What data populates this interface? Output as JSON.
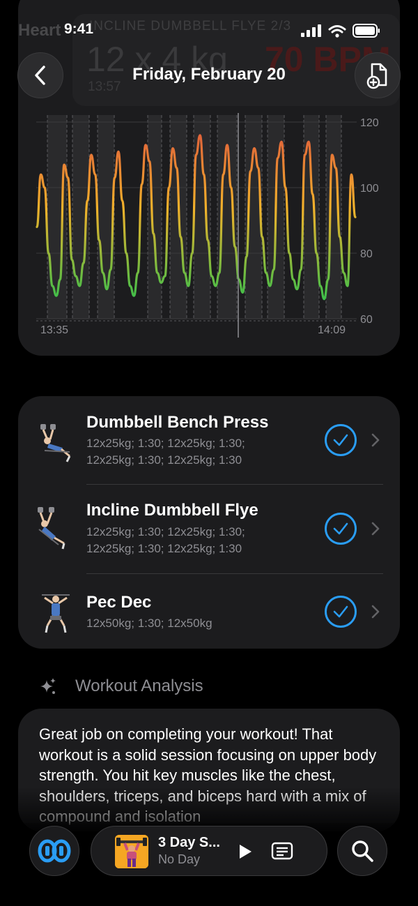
{
  "status_bar": {
    "time": "9:41"
  },
  "header": {
    "title": "Friday, February 20"
  },
  "background_overlay": {
    "section_title": "Heart",
    "exercise_label": "INCLINE DUMBBELL FLYE 2/3",
    "set_value": "12 x 4 kg",
    "elapsed": "13:57",
    "bpm": "70 BPM"
  },
  "heart_rate_chart": {
    "y_ticks": [
      "120",
      "100",
      "80",
      "60"
    ],
    "x_start": "13:35",
    "x_end": "14:09"
  },
  "chart_data": {
    "type": "line",
    "title": "",
    "xlabel": "",
    "ylabel": "",
    "x_range": [
      "13:35",
      "14:09"
    ],
    "ylim": [
      60,
      120
    ],
    "y_ticks": [
      60,
      80,
      100,
      120
    ],
    "grid": true,
    "series": [
      {
        "values": [
          88,
          104,
          100,
          80,
          70,
          67,
          72,
          107,
          103,
          78,
          73,
          70,
          77,
          96,
          110,
          104,
          84,
          74,
          69,
          75,
          103,
          111,
          96,
          80,
          70,
          67,
          74,
          101,
          113,
          108,
          86,
          74,
          71,
          73,
          100,
          112,
          106,
          85,
          74,
          70,
          80,
          110,
          116,
          104,
          84,
          73,
          70,
          74,
          104,
          113,
          100,
          82,
          72,
          68,
          79,
          105,
          112,
          106,
          85,
          74,
          70,
          75,
          109,
          114,
          100,
          80,
          72,
          69,
          75,
          110,
          114,
          98,
          80,
          70,
          66,
          72,
          110,
          106,
          85,
          74,
          70,
          104,
          91
        ]
      }
    ]
  },
  "exercises": [
    {
      "name": "Dumbbell Bench Press",
      "sets_line1": "12x25kg; 1:30; 12x25kg; 1:30;",
      "sets_line2": "12x25kg; 1:30; 12x25kg; 1:30"
    },
    {
      "name": "Incline Dumbbell Flye",
      "sets_line1": "12x25kg; 1:30; 12x25kg; 1:30;",
      "sets_line2": "12x25kg; 1:30; 12x25kg; 1:30"
    },
    {
      "name": "Pec Dec",
      "sets_line1": "12x50kg; 1:30; 12x50kg",
      "sets_line2": ""
    }
  ],
  "analysis": {
    "title": "Workout Analysis",
    "text": "Great job on completing your workout! That workout is a solid session focusing on upper body strength. You hit key muscles like the chest, shoulders, triceps, and biceps hard with a mix of compound and isolation"
  },
  "player": {
    "title": "3 Day S...",
    "subtitle": "No Day"
  },
  "colors": {
    "accent": "#2a9df4",
    "card": "#1c1c1e",
    "hr_high": "#e0613a",
    "hr_mid": "#f2b12b",
    "hr_low": "#3cbf4a"
  },
  "icons": [
    "back-icon",
    "add-document-icon",
    "checkmark-icon",
    "chevron-right-icon",
    "sparkles-icon",
    "app-logo-icon",
    "play-icon",
    "list-icon",
    "search-icon"
  ]
}
